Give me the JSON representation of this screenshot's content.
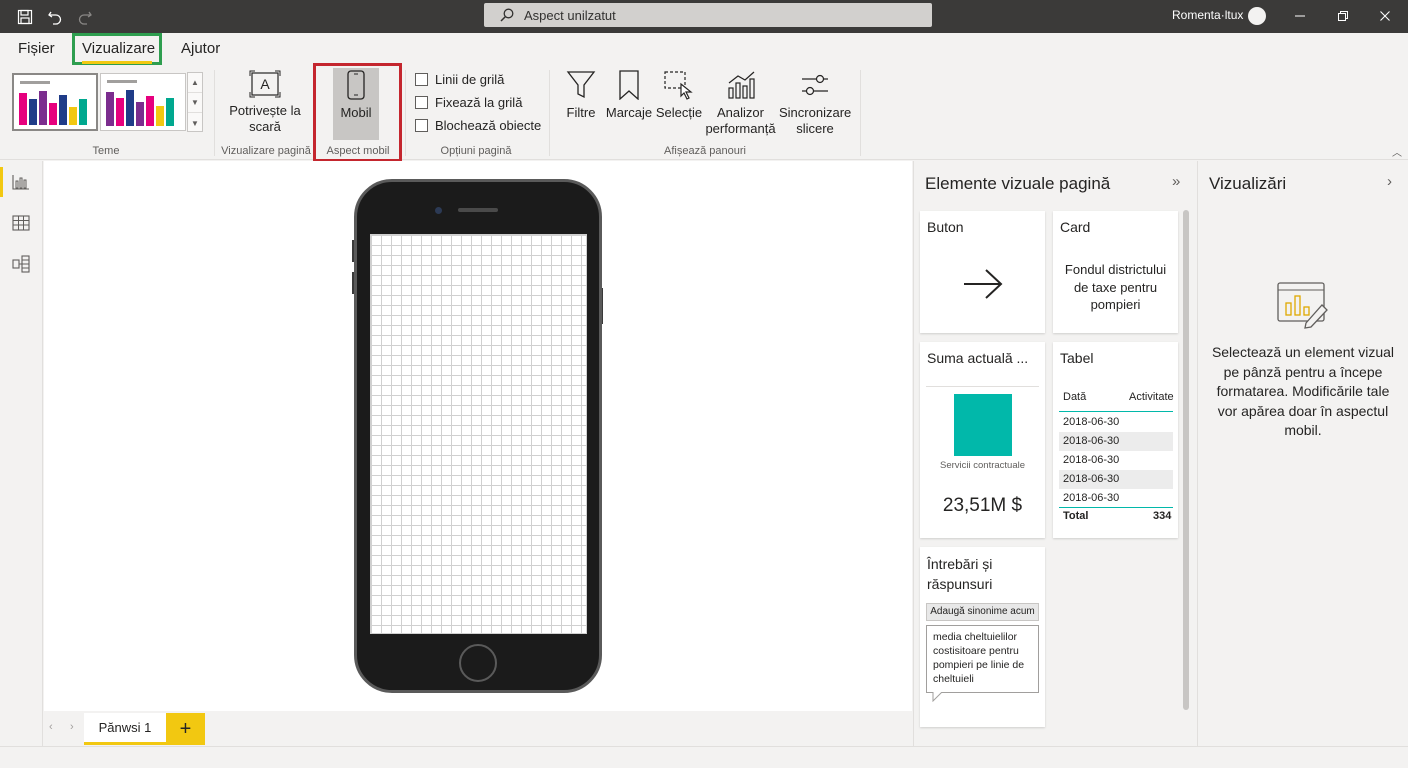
{
  "titlebar": {
    "search_placeholder": "Aspect unilzatut",
    "user_name": "Romenta·ltux"
  },
  "menu": {
    "items": [
      {
        "label": "Fișier"
      },
      {
        "label": "Vizualizare"
      },
      {
        "label": "Ajutor"
      }
    ],
    "active": "Vizualizare"
  },
  "ribbon": {
    "groups": {
      "themes": "Teme",
      "page_view": "Vizualizare pagină",
      "mobile_layout": "Aspect mobil",
      "page_options": "Opțiuni pagină",
      "show_panes": "Afișează panouri"
    },
    "fit_to_page": "Potrivește la scară",
    "mobile": "Mobil",
    "checkboxes": [
      {
        "label": "Linii de grilă",
        "checked": false
      },
      {
        "label": "Fixează la grilă",
        "checked": false
      },
      {
        "label": "Blochează obiecte",
        "checked": false
      }
    ],
    "panes": [
      {
        "label": "Filtre",
        "icon": "filter-icon"
      },
      {
        "label": "Marcaje",
        "icon": "bookmark-icon"
      },
      {
        "label": "Selecție",
        "icon": "selection-icon"
      },
      {
        "label": "Analizor performanță",
        "icon": "performance-analyzer-icon"
      },
      {
        "label": "Sincronizare slicere",
        "icon": "sync-slicers-icon"
      }
    ],
    "theme_colors": [
      "#e6007e",
      "#1f3c88",
      "#7b2d8e",
      "#f2c811",
      "#00a88f"
    ]
  },
  "page_tabs": {
    "tabs": [
      {
        "label": "Pănwsi 1"
      }
    ],
    "add_label": "+"
  },
  "page_visuals_pane": {
    "title": "Elemente vizuale pagină",
    "cards": {
      "button": {
        "title": "Buton"
      },
      "card": {
        "title": "Card",
        "text": "Fondul districtului de taxe pentru pompieri"
      },
      "sum": {
        "title": "Suma actuală ...",
        "category": "Servicii contractuale",
        "value": "23,51M $",
        "bar_color": "#01b8aa"
      },
      "table": {
        "title": "Tabel",
        "headers": [
          "Dată",
          "Activitate"
        ],
        "rows": [
          "2018-06-30",
          "2018-06-30",
          "2018-06-30",
          "2018-06-30",
          "2018-06-30"
        ],
        "total_label": "Total",
        "total_value": "334"
      },
      "qa": {
        "title": "Întrebări și răspunsuri",
        "button": "Adaugă sinonime acum",
        "question": "media cheltuielilor costisitoare pentru pompieri pe linie de cheltuieli"
      }
    }
  },
  "visualizations_pane": {
    "title": "Vizualizări",
    "message": "Selectează un element vizual pe pânză pentru a începe formatarea. Modificările tale vor apărea doar în aspectul mobil."
  },
  "colors": {
    "accent_yellow": "#f2c811",
    "highlight_green": "#2e9e4f",
    "highlight_red": "#c4262e",
    "titlebar": "#3b3a39"
  }
}
